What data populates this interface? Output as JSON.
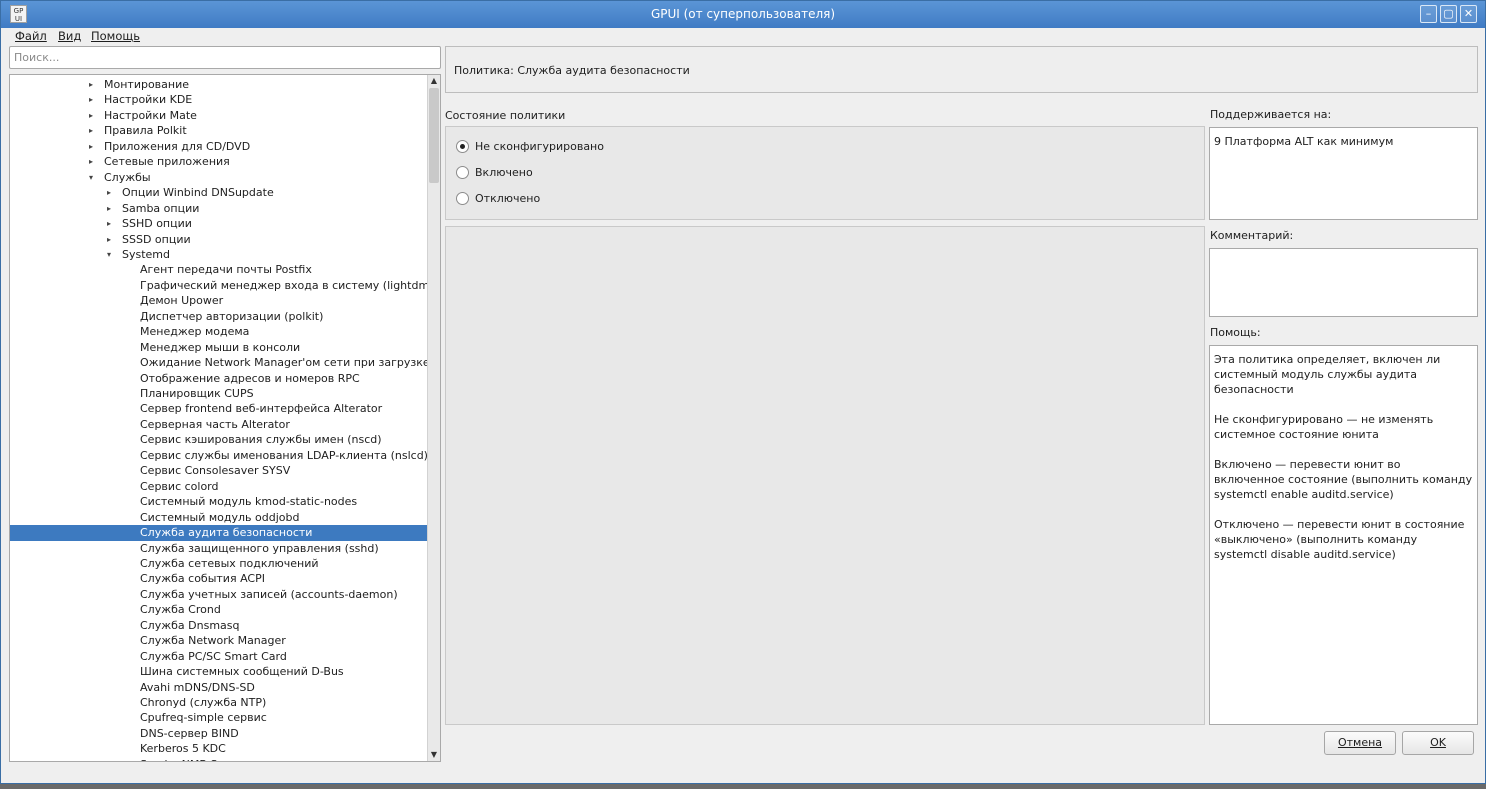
{
  "window": {
    "title": "GPUI (от суперпользователя)",
    "app_icon_text": "GP UI",
    "controls": [
      "–",
      "▢",
      "✕"
    ]
  },
  "menu": [
    "Файл",
    "Вид",
    "Помощь"
  ],
  "search": {
    "placeholder": "Поиск..."
  },
  "tree": [
    {
      "label": "Монтирование",
      "level": 1,
      "arrow": "right"
    },
    {
      "label": "Настройки KDE",
      "level": 1,
      "arrow": "right"
    },
    {
      "label": "Настройки Mate",
      "level": 1,
      "arrow": "right"
    },
    {
      "label": "Правила Polkit",
      "level": 1,
      "arrow": "right"
    },
    {
      "label": "Приложения для CD/DVD",
      "level": 1,
      "arrow": "right"
    },
    {
      "label": "Сетевые приложения",
      "level": 1,
      "arrow": "right"
    },
    {
      "label": "Службы",
      "level": 1,
      "arrow": "down"
    },
    {
      "label": "Опции Winbind DNSupdate",
      "level": 2,
      "arrow": "right"
    },
    {
      "label": "Samba опции",
      "level": 2,
      "arrow": "right"
    },
    {
      "label": "SSHD опции",
      "level": 2,
      "arrow": "right"
    },
    {
      "label": "SSSD опции",
      "level": 2,
      "arrow": "right"
    },
    {
      "label": "Systemd",
      "level": 2,
      "arrow": "down"
    },
    {
      "label": "Агент передачи почты Postfix",
      "level": 3
    },
    {
      "label": "Графический менеджер входа в систему (lightdm)",
      "level": 3
    },
    {
      "label": "Демон Upower",
      "level": 3
    },
    {
      "label": "Диспетчер авторизации (polkit)",
      "level": 3
    },
    {
      "label": "Менеджер модема",
      "level": 3
    },
    {
      "label": "Менеджер мыши в консоли",
      "level": 3
    },
    {
      "label": "Ожидание Network Manager'ом сети при загрузке",
      "level": 3
    },
    {
      "label": "Отображение адресов и номеров RPC",
      "level": 3
    },
    {
      "label": "Планировщик CUPS",
      "level": 3
    },
    {
      "label": "Сервер frontend веб-интерфейса Alterator",
      "level": 3
    },
    {
      "label": "Серверная часть Alterator",
      "level": 3
    },
    {
      "label": "Сервис кэширования службы имен (nscd)",
      "level": 3
    },
    {
      "label": "Сервис службы именования LDAP-клиента (nslcd)",
      "level": 3
    },
    {
      "label": "Сервис Consolesaver SYSV",
      "level": 3
    },
    {
      "label": "Сервис colord",
      "level": 3
    },
    {
      "label": "Системный модуль kmod-static-nodes",
      "level": 3
    },
    {
      "label": "Системный модуль oddjobd",
      "level": 3
    },
    {
      "label": "Служба аудита безопасности",
      "level": 3,
      "selected": true
    },
    {
      "label": "Служба защищенного управления (sshd)",
      "level": 3
    },
    {
      "label": "Служба сетевых подключений",
      "level": 3
    },
    {
      "label": "Служба события ACPI",
      "level": 3
    },
    {
      "label": "Служба учетных записей (accounts-daemon)",
      "level": 3
    },
    {
      "label": "Служба Crond",
      "level": 3
    },
    {
      "label": "Служба Dnsmasq",
      "level": 3
    },
    {
      "label": "Служба Network Manager",
      "level": 3
    },
    {
      "label": "Служба PC/SC Smart Card",
      "level": 3
    },
    {
      "label": "Шина системных сообщений D-Bus",
      "level": 3
    },
    {
      "label": "Avahi mDNS/DNS-SD",
      "level": 3
    },
    {
      "label": "Chronyd (служба NTP)",
      "level": 3
    },
    {
      "label": "Cpufreq-simple сервис",
      "level": 3
    },
    {
      "label": "DNS-сервер BIND",
      "level": 3
    },
    {
      "label": "Kerberos 5 KDC",
      "level": 3
    },
    {
      "label": "Samba NMB Server",
      "level": 3
    }
  ],
  "policy": {
    "header": "Политика: Служба аудита безопасности",
    "state_label": "Состояние политики",
    "options": [
      {
        "label": "Не сконфигурировано",
        "checked": true
      },
      {
        "label": "Включено",
        "checked": false
      },
      {
        "label": "Отключено",
        "checked": false
      }
    ]
  },
  "right": {
    "supported_label": "Поддерживается на:",
    "supported_value": "9 Платформа ALT как минимум",
    "comment_label": "Комментарий:",
    "comment_value": "",
    "help_label": "Помощь:",
    "help_paragraphs": [
      "Эта политика определяет, включен ли системный модуль службы аудита безопасности",
      "Не сконфигурировано — не изменять системное состояние юнита",
      "Включено — перевести юнит во включенное состояние (выполнить команду systemctl enable auditd.service)",
      "Отключено — перевести юнит в состояние «выключено» (выполнить команду systemctl disable auditd.service)"
    ]
  },
  "buttons": {
    "cancel": "Отмена",
    "ok": "OK"
  }
}
